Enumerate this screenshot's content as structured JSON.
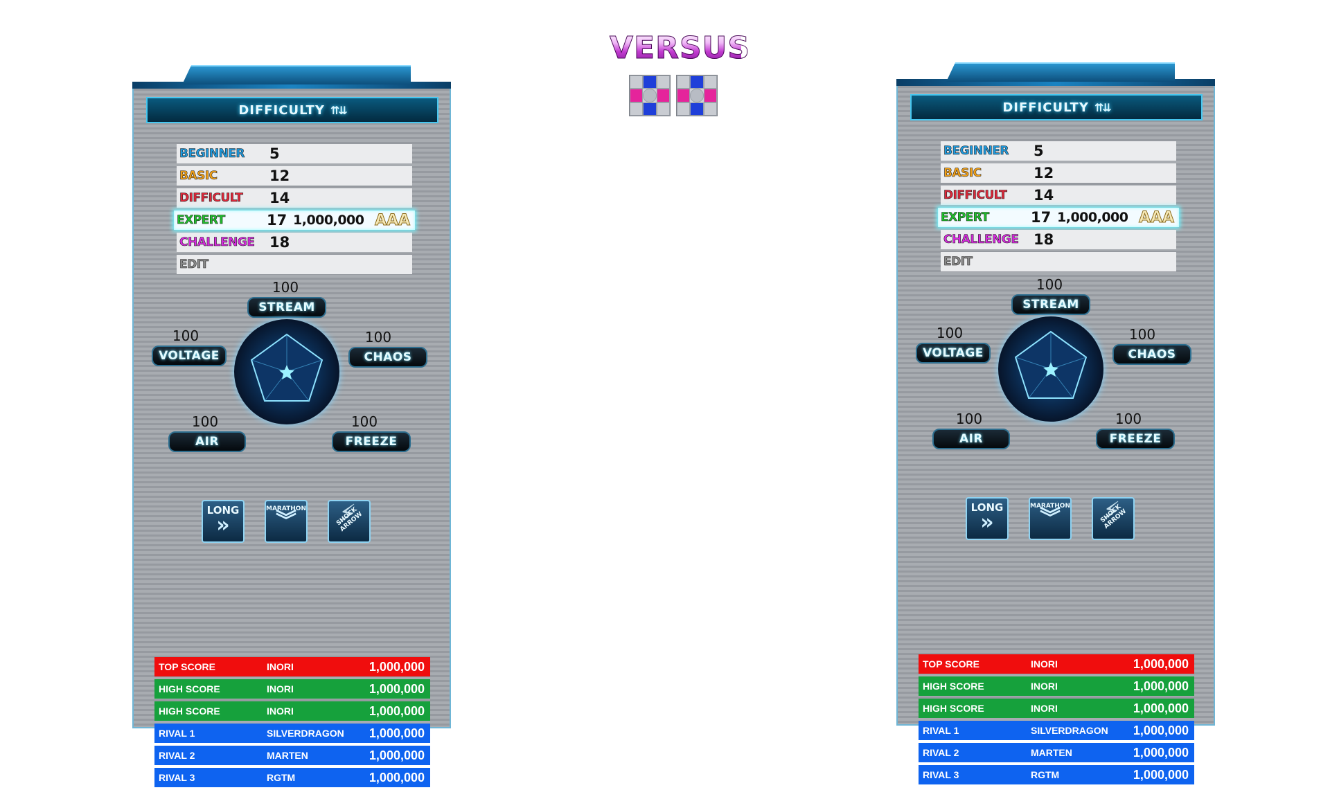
{
  "header": {
    "title": "VERSUS",
    "pads": [
      "dance-pad-icon",
      "dance-pad-icon"
    ]
  },
  "colors": {
    "beginner": "#1e9be0",
    "basic": "#f3a116",
    "difficult": "#e0283a",
    "expert": "#1fc12b",
    "challenge": "#d82ae0",
    "edit": "#8a8a8a",
    "top_score": "#f00d0d",
    "high_score": "#16a13c",
    "rival": "#0e63f0"
  },
  "players": [
    {
      "difficulty_header": "DIFFICULTY",
      "difficulty_arrows": "⇈⇊",
      "difficulties": [
        {
          "name": "BEGINNER",
          "level": "5",
          "score": "",
          "grade": "",
          "color": "#1e9be0"
        },
        {
          "name": "BASIC",
          "level": "12",
          "score": "",
          "grade": "",
          "color": "#f3a116"
        },
        {
          "name": "DIFFICULT",
          "level": "14",
          "score": "",
          "grade": "",
          "color": "#e0283a"
        },
        {
          "name": "EXPERT",
          "level": "17",
          "score": "1,000,000",
          "grade": "AAA",
          "color": "#1fc12b",
          "selected": true
        },
        {
          "name": "CHALLENGE",
          "level": "18",
          "score": "",
          "grade": "",
          "color": "#d82ae0"
        },
        {
          "name": "EDIT",
          "level": "",
          "score": "",
          "grade": "",
          "color": "#8a8a8a"
        }
      ],
      "radar": {
        "stream": {
          "label": "STREAM",
          "value": "100"
        },
        "voltage": {
          "label": "VOLTAGE",
          "value": "100"
        },
        "chaos": {
          "label": "CHAOS",
          "value": "100"
        },
        "air": {
          "label": "AIR",
          "value": "100"
        },
        "freeze": {
          "label": "FREEZE",
          "value": "100"
        }
      },
      "options": [
        {
          "label": "LONG",
          "icon": "long-chevron-icon"
        },
        {
          "label": "MARATHON",
          "icon": "marathon-chevron-icon"
        },
        {
          "label": "SHOCK ARROW",
          "icon": "shock-arrow-icon"
        }
      ],
      "scores": [
        {
          "type": "TOP SCORE",
          "name": "INORI",
          "value": "1,000,000",
          "kind": "top"
        },
        {
          "type": "HIGH SCORE",
          "name": "INORI",
          "value": "1,000,000",
          "kind": "high"
        },
        {
          "type": "HIGH SCORE",
          "name": "INORI",
          "value": "1,000,000",
          "kind": "high"
        },
        {
          "type": "RIVAL 1",
          "name": "SILVERDRAGON",
          "value": "1,000,000",
          "kind": "rival"
        },
        {
          "type": "RIVAL 2",
          "name": "MARTEN",
          "value": "1,000,000",
          "kind": "rival"
        },
        {
          "type": "RIVAL 3",
          "name": "RGTM",
          "value": "1,000,000",
          "kind": "rival"
        }
      ]
    },
    {
      "difficulty_header": "DIFFICULTY",
      "difficulty_arrows": "⇈⇊",
      "difficulties": [
        {
          "name": "BEGINNER",
          "level": "5",
          "score": "",
          "grade": "",
          "color": "#1e9be0"
        },
        {
          "name": "BASIC",
          "level": "12",
          "score": "",
          "grade": "",
          "color": "#f3a116"
        },
        {
          "name": "DIFFICULT",
          "level": "14",
          "score": "",
          "grade": "",
          "color": "#e0283a"
        },
        {
          "name": "EXPERT",
          "level": "17",
          "score": "1,000,000",
          "grade": "AAA",
          "color": "#1fc12b",
          "selected": true
        },
        {
          "name": "CHALLENGE",
          "level": "18",
          "score": "",
          "grade": "",
          "color": "#d82ae0"
        },
        {
          "name": "EDIT",
          "level": "",
          "score": "",
          "grade": "",
          "color": "#8a8a8a"
        }
      ],
      "radar": {
        "stream": {
          "label": "STREAM",
          "value": "100"
        },
        "voltage": {
          "label": "VOLTAGE",
          "value": "100"
        },
        "chaos": {
          "label": "CHAOS",
          "value": "100"
        },
        "air": {
          "label": "AIR",
          "value": "100"
        },
        "freeze": {
          "label": "FREEZE",
          "value": "100"
        }
      },
      "options": [
        {
          "label": "LONG",
          "icon": "long-chevron-icon"
        },
        {
          "label": "MARATHON",
          "icon": "marathon-chevron-icon"
        },
        {
          "label": "SHOCK ARROW",
          "icon": "shock-arrow-icon"
        }
      ],
      "scores": [
        {
          "type": "TOP SCORE",
          "name": "INORI",
          "value": "1,000,000",
          "kind": "top"
        },
        {
          "type": "HIGH SCORE",
          "name": "INORI",
          "value": "1,000,000",
          "kind": "high"
        },
        {
          "type": "HIGH SCORE",
          "name": "INORI",
          "value": "1,000,000",
          "kind": "high"
        },
        {
          "type": "RIVAL 1",
          "name": "SILVERDRAGON",
          "value": "1,000,000",
          "kind": "rival"
        },
        {
          "type": "RIVAL 2",
          "name": "MARTEN",
          "value": "1,000,000",
          "kind": "rival"
        },
        {
          "type": "RIVAL 3",
          "name": "RGTM",
          "value": "1,000,000",
          "kind": "rival"
        }
      ]
    }
  ]
}
